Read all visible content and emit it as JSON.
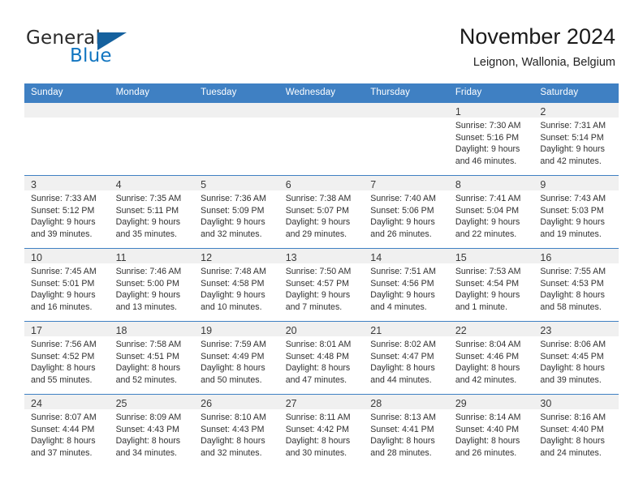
{
  "brand": {
    "name_part1": "General",
    "name_part2": "Blue",
    "logo_icon": "triangle-icon",
    "accent_color": "#15619e",
    "blue_text_color": "#1175c0"
  },
  "header": {
    "title": "November 2024",
    "location": "Leignon, Wallonia, Belgium"
  },
  "calendar": {
    "header_bg": "#3f80c3",
    "date_band_bg": "#f0f0f0",
    "weekday_headers": [
      "Sunday",
      "Monday",
      "Tuesday",
      "Wednesday",
      "Thursday",
      "Friday",
      "Saturday"
    ],
    "weeks": [
      [
        {
          "empty": true
        },
        {
          "empty": true
        },
        {
          "empty": true
        },
        {
          "empty": true
        },
        {
          "empty": true
        },
        {
          "empty": false,
          "date": "1",
          "sunrise": "Sunrise: 7:30 AM",
          "sunset": "Sunset: 5:16 PM",
          "daylight_line1": "Daylight: 9 hours",
          "daylight_line2": "and 46 minutes."
        },
        {
          "empty": false,
          "date": "2",
          "sunrise": "Sunrise: 7:31 AM",
          "sunset": "Sunset: 5:14 PM",
          "daylight_line1": "Daylight: 9 hours",
          "daylight_line2": "and 42 minutes."
        }
      ],
      [
        {
          "empty": false,
          "date": "3",
          "sunrise": "Sunrise: 7:33 AM",
          "sunset": "Sunset: 5:12 PM",
          "daylight_line1": "Daylight: 9 hours",
          "daylight_line2": "and 39 minutes."
        },
        {
          "empty": false,
          "date": "4",
          "sunrise": "Sunrise: 7:35 AM",
          "sunset": "Sunset: 5:11 PM",
          "daylight_line1": "Daylight: 9 hours",
          "daylight_line2": "and 35 minutes."
        },
        {
          "empty": false,
          "date": "5",
          "sunrise": "Sunrise: 7:36 AM",
          "sunset": "Sunset: 5:09 PM",
          "daylight_line1": "Daylight: 9 hours",
          "daylight_line2": "and 32 minutes."
        },
        {
          "empty": false,
          "date": "6",
          "sunrise": "Sunrise: 7:38 AM",
          "sunset": "Sunset: 5:07 PM",
          "daylight_line1": "Daylight: 9 hours",
          "daylight_line2": "and 29 minutes."
        },
        {
          "empty": false,
          "date": "7",
          "sunrise": "Sunrise: 7:40 AM",
          "sunset": "Sunset: 5:06 PM",
          "daylight_line1": "Daylight: 9 hours",
          "daylight_line2": "and 26 minutes."
        },
        {
          "empty": false,
          "date": "8",
          "sunrise": "Sunrise: 7:41 AM",
          "sunset": "Sunset: 5:04 PM",
          "daylight_line1": "Daylight: 9 hours",
          "daylight_line2": "and 22 minutes."
        },
        {
          "empty": false,
          "date": "9",
          "sunrise": "Sunrise: 7:43 AM",
          "sunset": "Sunset: 5:03 PM",
          "daylight_line1": "Daylight: 9 hours",
          "daylight_line2": "and 19 minutes."
        }
      ],
      [
        {
          "empty": false,
          "date": "10",
          "sunrise": "Sunrise: 7:45 AM",
          "sunset": "Sunset: 5:01 PM",
          "daylight_line1": "Daylight: 9 hours",
          "daylight_line2": "and 16 minutes."
        },
        {
          "empty": false,
          "date": "11",
          "sunrise": "Sunrise: 7:46 AM",
          "sunset": "Sunset: 5:00 PM",
          "daylight_line1": "Daylight: 9 hours",
          "daylight_line2": "and 13 minutes."
        },
        {
          "empty": false,
          "date": "12",
          "sunrise": "Sunrise: 7:48 AM",
          "sunset": "Sunset: 4:58 PM",
          "daylight_line1": "Daylight: 9 hours",
          "daylight_line2": "and 10 minutes."
        },
        {
          "empty": false,
          "date": "13",
          "sunrise": "Sunrise: 7:50 AM",
          "sunset": "Sunset: 4:57 PM",
          "daylight_line1": "Daylight: 9 hours",
          "daylight_line2": "and 7 minutes."
        },
        {
          "empty": false,
          "date": "14",
          "sunrise": "Sunrise: 7:51 AM",
          "sunset": "Sunset: 4:56 PM",
          "daylight_line1": "Daylight: 9 hours",
          "daylight_line2": "and 4 minutes."
        },
        {
          "empty": false,
          "date": "15",
          "sunrise": "Sunrise: 7:53 AM",
          "sunset": "Sunset: 4:54 PM",
          "daylight_line1": "Daylight: 9 hours",
          "daylight_line2": "and 1 minute."
        },
        {
          "empty": false,
          "date": "16",
          "sunrise": "Sunrise: 7:55 AM",
          "sunset": "Sunset: 4:53 PM",
          "daylight_line1": "Daylight: 8 hours",
          "daylight_line2": "and 58 minutes."
        }
      ],
      [
        {
          "empty": false,
          "date": "17",
          "sunrise": "Sunrise: 7:56 AM",
          "sunset": "Sunset: 4:52 PM",
          "daylight_line1": "Daylight: 8 hours",
          "daylight_line2": "and 55 minutes."
        },
        {
          "empty": false,
          "date": "18",
          "sunrise": "Sunrise: 7:58 AM",
          "sunset": "Sunset: 4:51 PM",
          "daylight_line1": "Daylight: 8 hours",
          "daylight_line2": "and 52 minutes."
        },
        {
          "empty": false,
          "date": "19",
          "sunrise": "Sunrise: 7:59 AM",
          "sunset": "Sunset: 4:49 PM",
          "daylight_line1": "Daylight: 8 hours",
          "daylight_line2": "and 50 minutes."
        },
        {
          "empty": false,
          "date": "20",
          "sunrise": "Sunrise: 8:01 AM",
          "sunset": "Sunset: 4:48 PM",
          "daylight_line1": "Daylight: 8 hours",
          "daylight_line2": "and 47 minutes."
        },
        {
          "empty": false,
          "date": "21",
          "sunrise": "Sunrise: 8:02 AM",
          "sunset": "Sunset: 4:47 PM",
          "daylight_line1": "Daylight: 8 hours",
          "daylight_line2": "and 44 minutes."
        },
        {
          "empty": false,
          "date": "22",
          "sunrise": "Sunrise: 8:04 AM",
          "sunset": "Sunset: 4:46 PM",
          "daylight_line1": "Daylight: 8 hours",
          "daylight_line2": "and 42 minutes."
        },
        {
          "empty": false,
          "date": "23",
          "sunrise": "Sunrise: 8:06 AM",
          "sunset": "Sunset: 4:45 PM",
          "daylight_line1": "Daylight: 8 hours",
          "daylight_line2": "and 39 minutes."
        }
      ],
      [
        {
          "empty": false,
          "date": "24",
          "sunrise": "Sunrise: 8:07 AM",
          "sunset": "Sunset: 4:44 PM",
          "daylight_line1": "Daylight: 8 hours",
          "daylight_line2": "and 37 minutes."
        },
        {
          "empty": false,
          "date": "25",
          "sunrise": "Sunrise: 8:09 AM",
          "sunset": "Sunset: 4:43 PM",
          "daylight_line1": "Daylight: 8 hours",
          "daylight_line2": "and 34 minutes."
        },
        {
          "empty": false,
          "date": "26",
          "sunrise": "Sunrise: 8:10 AM",
          "sunset": "Sunset: 4:43 PM",
          "daylight_line1": "Daylight: 8 hours",
          "daylight_line2": "and 32 minutes."
        },
        {
          "empty": false,
          "date": "27",
          "sunrise": "Sunrise: 8:11 AM",
          "sunset": "Sunset: 4:42 PM",
          "daylight_line1": "Daylight: 8 hours",
          "daylight_line2": "and 30 minutes."
        },
        {
          "empty": false,
          "date": "28",
          "sunrise": "Sunrise: 8:13 AM",
          "sunset": "Sunset: 4:41 PM",
          "daylight_line1": "Daylight: 8 hours",
          "daylight_line2": "and 28 minutes."
        },
        {
          "empty": false,
          "date": "29",
          "sunrise": "Sunrise: 8:14 AM",
          "sunset": "Sunset: 4:40 PM",
          "daylight_line1": "Daylight: 8 hours",
          "daylight_line2": "and 26 minutes."
        },
        {
          "empty": false,
          "date": "30",
          "sunrise": "Sunrise: 8:16 AM",
          "sunset": "Sunset: 4:40 PM",
          "daylight_line1": "Daylight: 8 hours",
          "daylight_line2": "and 24 minutes."
        }
      ]
    ]
  }
}
